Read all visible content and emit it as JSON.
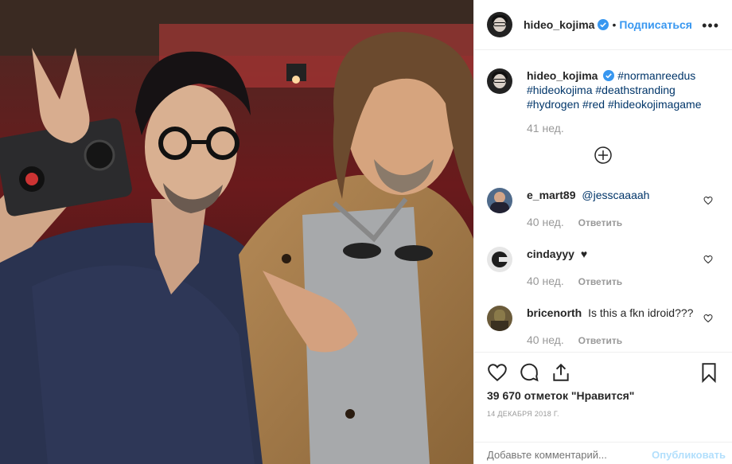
{
  "header": {
    "username": "hideo_kojima",
    "separator": "•",
    "follow_label": "Подписаться",
    "more_label": "•••"
  },
  "caption": {
    "username": "hideo_kojima",
    "text": "#normanreedus #hideokojima #deathstranding #hydrogen #red #hideokojimagame",
    "time": "41 нед."
  },
  "comments": [
    {
      "username": "e_mart89",
      "text": "@jesscaaaah",
      "time": "40 нед.",
      "reply_label": "Ответить"
    },
    {
      "username": "cindayyy",
      "text": "♥",
      "time": "40 нед.",
      "reply_label": "Ответить"
    },
    {
      "username": "bricenorth",
      "text": "Is this a fkn idroid???",
      "time": "40 нед.",
      "reply_label": "Ответить"
    }
  ],
  "actions": {
    "likes": "39 670 отметок \"Нравится\"",
    "date": "14 ДЕКАБРЯ 2018 Г."
  },
  "add_comment": {
    "placeholder": "Добавьте комментарий...",
    "publish_label": "Опубликовать"
  },
  "colors": {
    "accent": "#3897f0",
    "hashtag": "#003569",
    "muted": "#999999",
    "publish_disabled": "#b2dffc"
  },
  "icons": [
    "verified-badge-icon",
    "more-options-icon",
    "load-more-comments-icon",
    "heart-icon",
    "comment-icon",
    "share-icon",
    "bookmark-icon"
  ]
}
